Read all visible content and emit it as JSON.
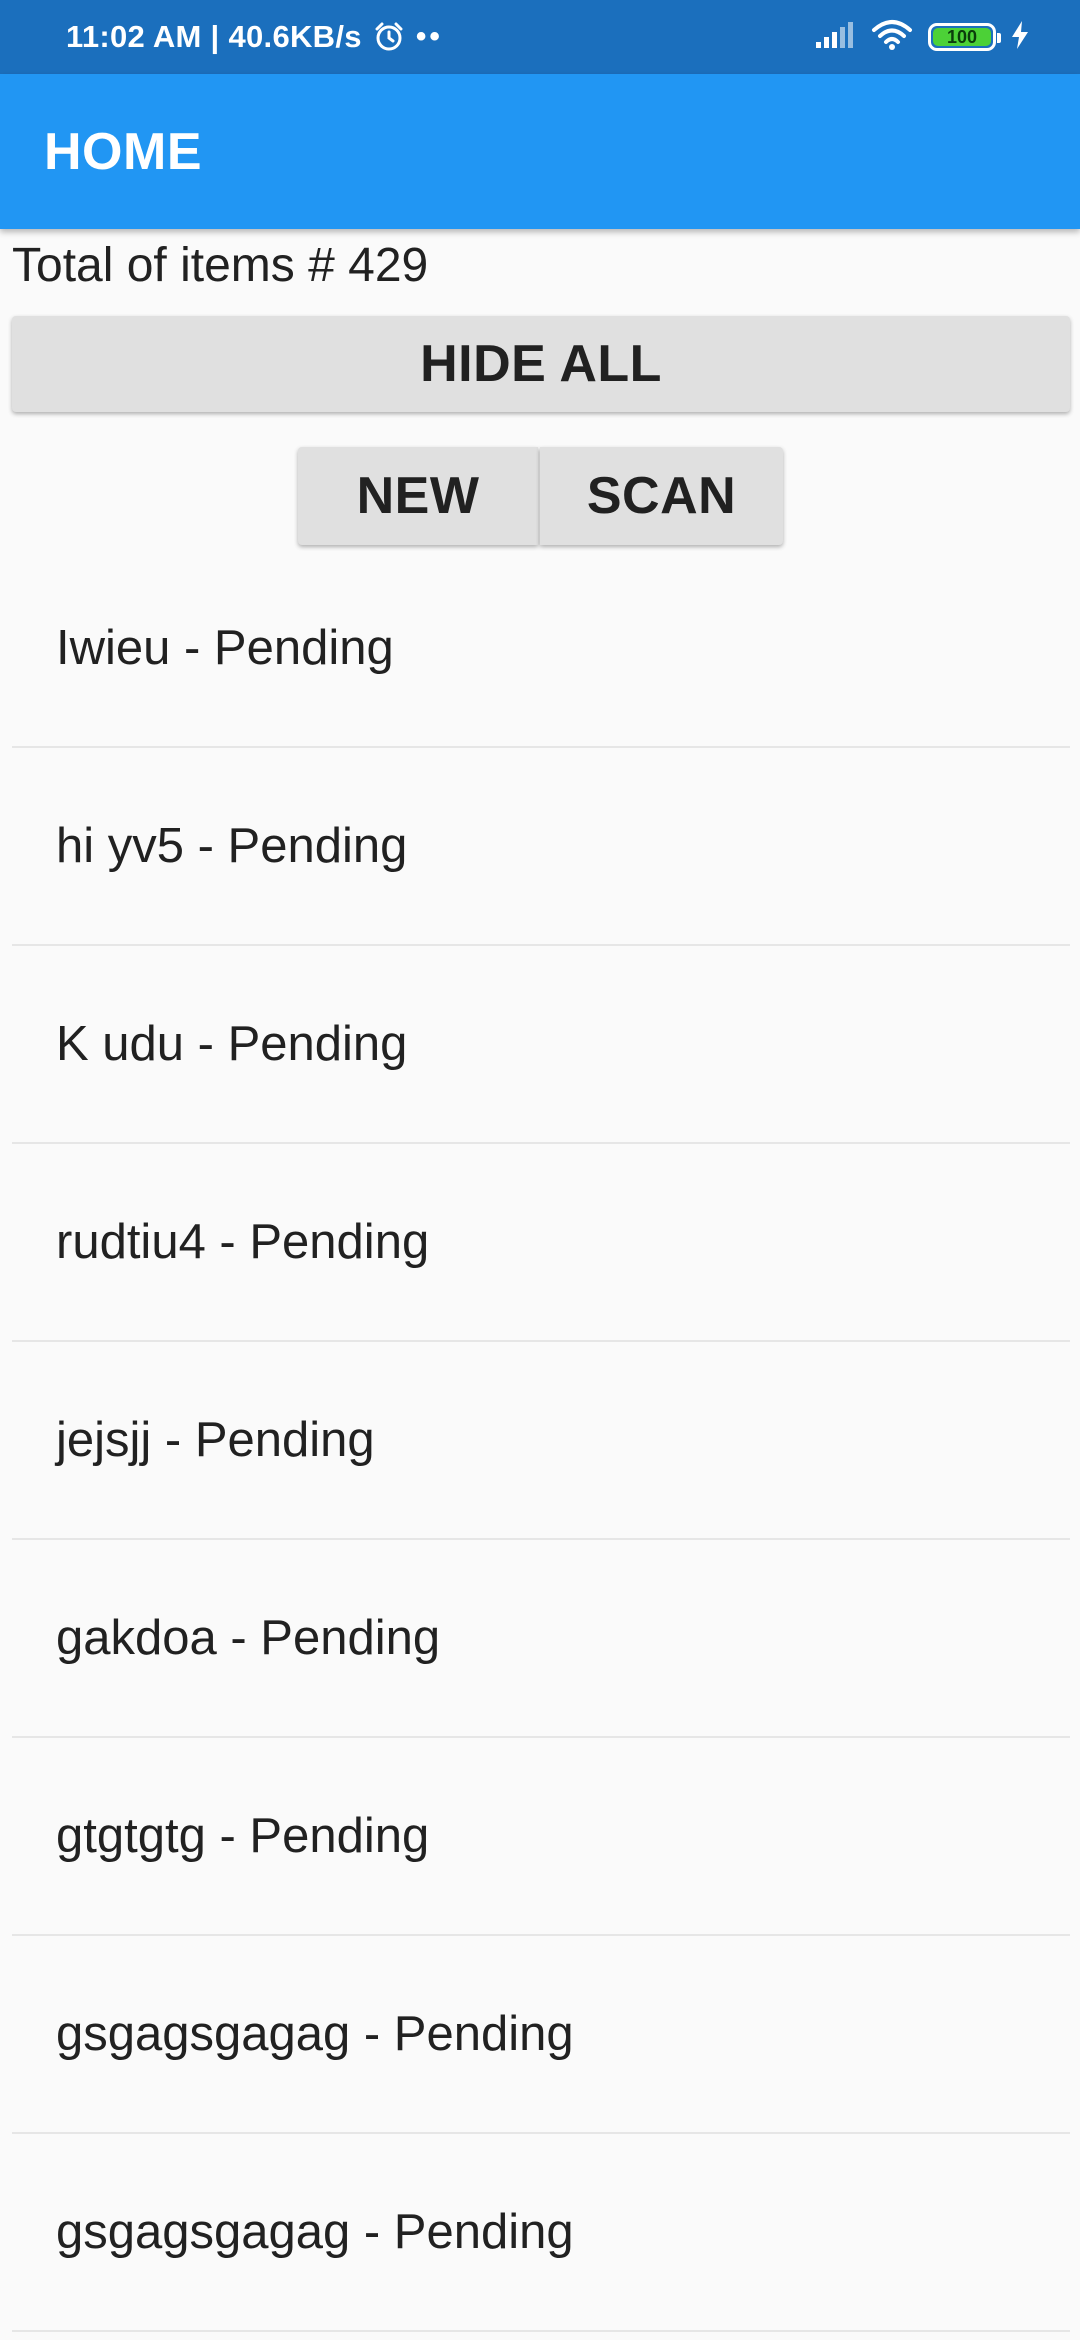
{
  "status_bar": {
    "time_text": "11:02 AM | 40.6KB/s",
    "dots": "••",
    "battery_level": "100",
    "battery_color": "#4cd137",
    "icons": [
      "alarm-icon",
      "signal-icon",
      "wifi-icon",
      "battery-icon",
      "charging-icon"
    ]
  },
  "app_bar": {
    "title": "HOME",
    "color": "#2196f3"
  },
  "summary": {
    "total_text": "Total of items # 429"
  },
  "buttons": {
    "hide_all": "HIDE ALL",
    "new": "NEW",
    "scan": "SCAN"
  },
  "items": [
    {
      "label": "Iwieu - Pending"
    },
    {
      "label": "hi yv5 - Pending"
    },
    {
      "label": "K udu - Pending"
    },
    {
      "label": "rudtiu4 - Pending"
    },
    {
      "label": "jejsjj - Pending"
    },
    {
      "label": "gakdoa - Pending"
    },
    {
      "label": "gtgtgtg - Pending"
    },
    {
      "label": "gsgagsgagag - Pending"
    },
    {
      "label": "gsgagsgagag - Pending"
    }
  ]
}
